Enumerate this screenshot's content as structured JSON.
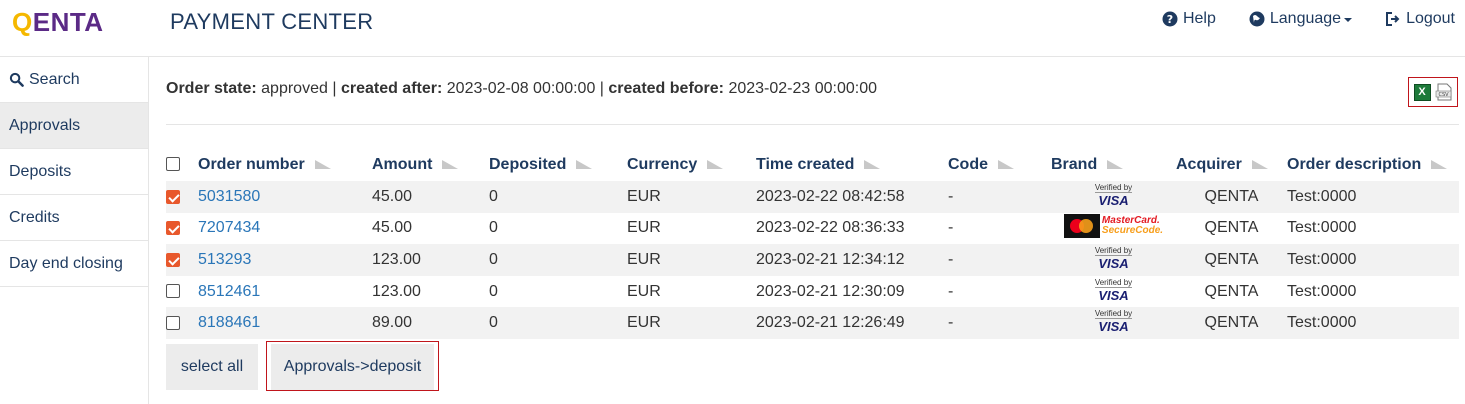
{
  "header": {
    "logo_q": "Q",
    "logo_rest": "ENTA",
    "title": "PAYMENT CENTER",
    "help_label": "Help",
    "language_label": "Language",
    "logout_label": "Logout"
  },
  "sidebar": {
    "items": [
      {
        "label": "Search",
        "icon": "search-icon"
      },
      {
        "label": "Approvals",
        "active": true
      },
      {
        "label": "Deposits"
      },
      {
        "label": "Credits"
      },
      {
        "label": "Day end closing"
      }
    ]
  },
  "filter": {
    "state_label": "Order state:",
    "state_value": "approved",
    "sep1": "|",
    "after_label": "created after:",
    "after_value": "2023-02-08 00:00:00",
    "sep2": "|",
    "before_label": "created before:",
    "before_value": "2023-02-23 00:00:00"
  },
  "export": {
    "xls_icon": "excel-icon",
    "csv_icon": "csv-icon",
    "xls_glyph": "X"
  },
  "table": {
    "columns": [
      "Order number",
      "Amount",
      "Deposited",
      "Currency",
      "Time created",
      "Code",
      "Brand",
      "Acquirer",
      "Order description"
    ],
    "rows": [
      {
        "checked": true,
        "order": "5031580",
        "amount": "45.00",
        "deposited": "0",
        "currency": "EUR",
        "time": "2023-02-22 08:42:58",
        "code": "-",
        "brand": "visa",
        "acquirer": "QENTA",
        "description": "Test:0000"
      },
      {
        "checked": true,
        "order": "7207434",
        "amount": "45.00",
        "deposited": "0",
        "currency": "EUR",
        "time": "2023-02-22 08:36:33",
        "code": "-",
        "brand": "mastercard",
        "acquirer": "QENTA",
        "description": "Test:0000"
      },
      {
        "checked": true,
        "order": "513293",
        "amount": "123.00",
        "deposited": "0",
        "currency": "EUR",
        "time": "2023-02-21 12:34:12",
        "code": "-",
        "brand": "visa",
        "acquirer": "QENTA",
        "description": "Test:0000"
      },
      {
        "checked": false,
        "order": "8512461",
        "amount": "123.00",
        "deposited": "0",
        "currency": "EUR",
        "time": "2023-02-21 12:30:09",
        "code": "-",
        "brand": "visa",
        "acquirer": "QENTA",
        "description": "Test:0000"
      },
      {
        "checked": false,
        "order": "8188461",
        "amount": "89.00",
        "deposited": "0",
        "currency": "EUR",
        "time": "2023-02-21 12:26:49",
        "code": "-",
        "brand": "visa",
        "acquirer": "QENTA",
        "description": "Test:0000"
      }
    ]
  },
  "brand_logos": {
    "visa_line1": "Verified by",
    "visa_line2": "VISA",
    "mc_line1": "MasterCard.",
    "mc_line2": "SecureCode."
  },
  "actions": {
    "select_all_label": "select all",
    "deposit_label": "Approvals->deposit"
  },
  "colors": {
    "accent_link": "#2a76b8",
    "nav_text": "#1e3a5f",
    "checkbox_checked": "#e8582c",
    "highlight_border": "#c0151b"
  }
}
